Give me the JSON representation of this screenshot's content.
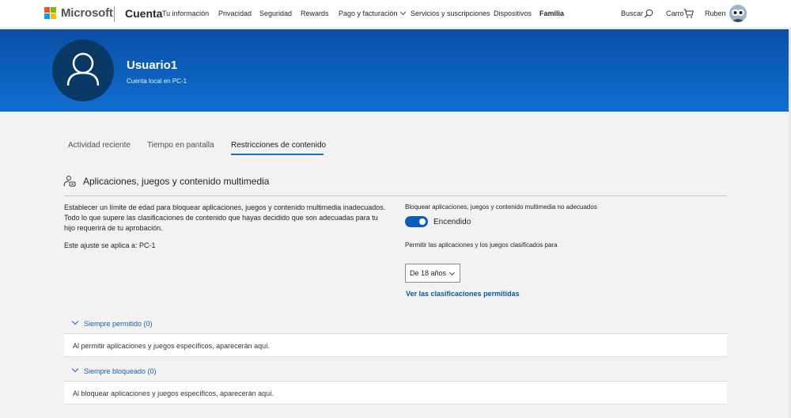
{
  "nav": {
    "brand": "Microsoft",
    "product": "Cuenta",
    "links": [
      {
        "label": "Tu información"
      },
      {
        "label": "Privacidad"
      },
      {
        "label": "Seguridad"
      },
      {
        "label": "Rewards"
      },
      {
        "label": "Pago y facturación"
      },
      {
        "label": "Servicios y suscripciones"
      },
      {
        "label": "Dispositivos"
      },
      {
        "label": "Familia"
      }
    ],
    "search_label": "Buscar",
    "cart_label": "Carro",
    "user_label": "Ruben"
  },
  "banner": {
    "name": "Usuario1",
    "subtitle": "Cuenta local en PC-1"
  },
  "tabs": [
    {
      "label": "Actividad reciente"
    },
    {
      "label": "Tiempo en pantalla"
    },
    {
      "label": "Restricciones de contenido",
      "active": true
    }
  ],
  "section": {
    "title": "Aplicaciones, juegos y contenido multimedia",
    "description": "Establecer un límite de edad para bloquear aplicaciones, juegos y contenido multimedia inadecuados. Todo lo que supere las clasificaciones de contenido que hayas decidido que son adecuadas para tu hijo requerirá de tu aprobación.",
    "applies_to": "Este ajuste se aplica a: PC-1",
    "block_label": "Bloquear aplicaciones, juegos y contenido multimedia no adecuados",
    "toggle_on": true,
    "toggle_label": "Encendido",
    "allow_label": "Permitir las aplicaciones y los juegos clasificados para",
    "age_selected": "De 18 años",
    "ratings_link": "Ver las clasificaciones permitidas"
  },
  "accordions": [
    {
      "label": "Siempre permitido (0)",
      "body": "Al permitir aplicaciones y juegos específicos, aparecerán aquí."
    },
    {
      "label": "Siempre bloqueado (0)",
      "body": "Al bloquear aplicaciones y juegos específicos, aparecerán aquí."
    }
  ],
  "colors": {
    "banner": "#0f6fd1",
    "accent": "#0b5db8",
    "link": "#0b57a3"
  }
}
